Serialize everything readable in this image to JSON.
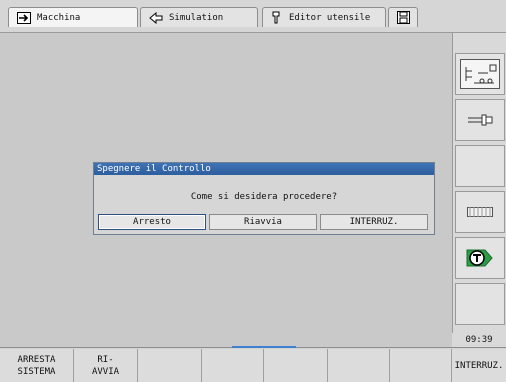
{
  "tabs": [
    {
      "label": "Macchina",
      "icon": "machine-arrow-icon",
      "active": true
    },
    {
      "label": "Simulation",
      "icon": "simulation-arrow-icon",
      "active": false
    },
    {
      "label": "Editor utensile",
      "icon": "tool-editor-icon",
      "active": false
    },
    {
      "label": "",
      "icon": "save-disk-icon",
      "active": false
    }
  ],
  "dialog": {
    "title": "Spegnere il Controllo",
    "question": "Come si desidera procedere?",
    "buttons": [
      "Arresto",
      "Riavvia",
      "INTERRUZ."
    ]
  },
  "sidebar": {
    "buttons": [
      {
        "icon": "machine-mode-icon"
      },
      {
        "icon": "tool-holder-icon"
      },
      {
        "icon": "blank-softkey"
      },
      {
        "icon": "program-strip-icon"
      },
      {
        "icon": "tool-t-icon"
      },
      {
        "icon": "blank-softkey"
      }
    ],
    "clock": "09:39"
  },
  "softkeys": [
    {
      "line1": "ARRESTA",
      "line2": "SISTEMA"
    },
    {
      "line1": "RI-",
      "line2": "AVVIA"
    },
    {
      "line1": "",
      "line2": ""
    },
    {
      "line1": "",
      "line2": ""
    },
    {
      "line1": "",
      "line2": ""
    },
    {
      "line1": "",
      "line2": ""
    },
    {
      "line1": "",
      "line2": ""
    },
    {
      "line1": "INTERRUZ.",
      "line2": ""
    }
  ]
}
